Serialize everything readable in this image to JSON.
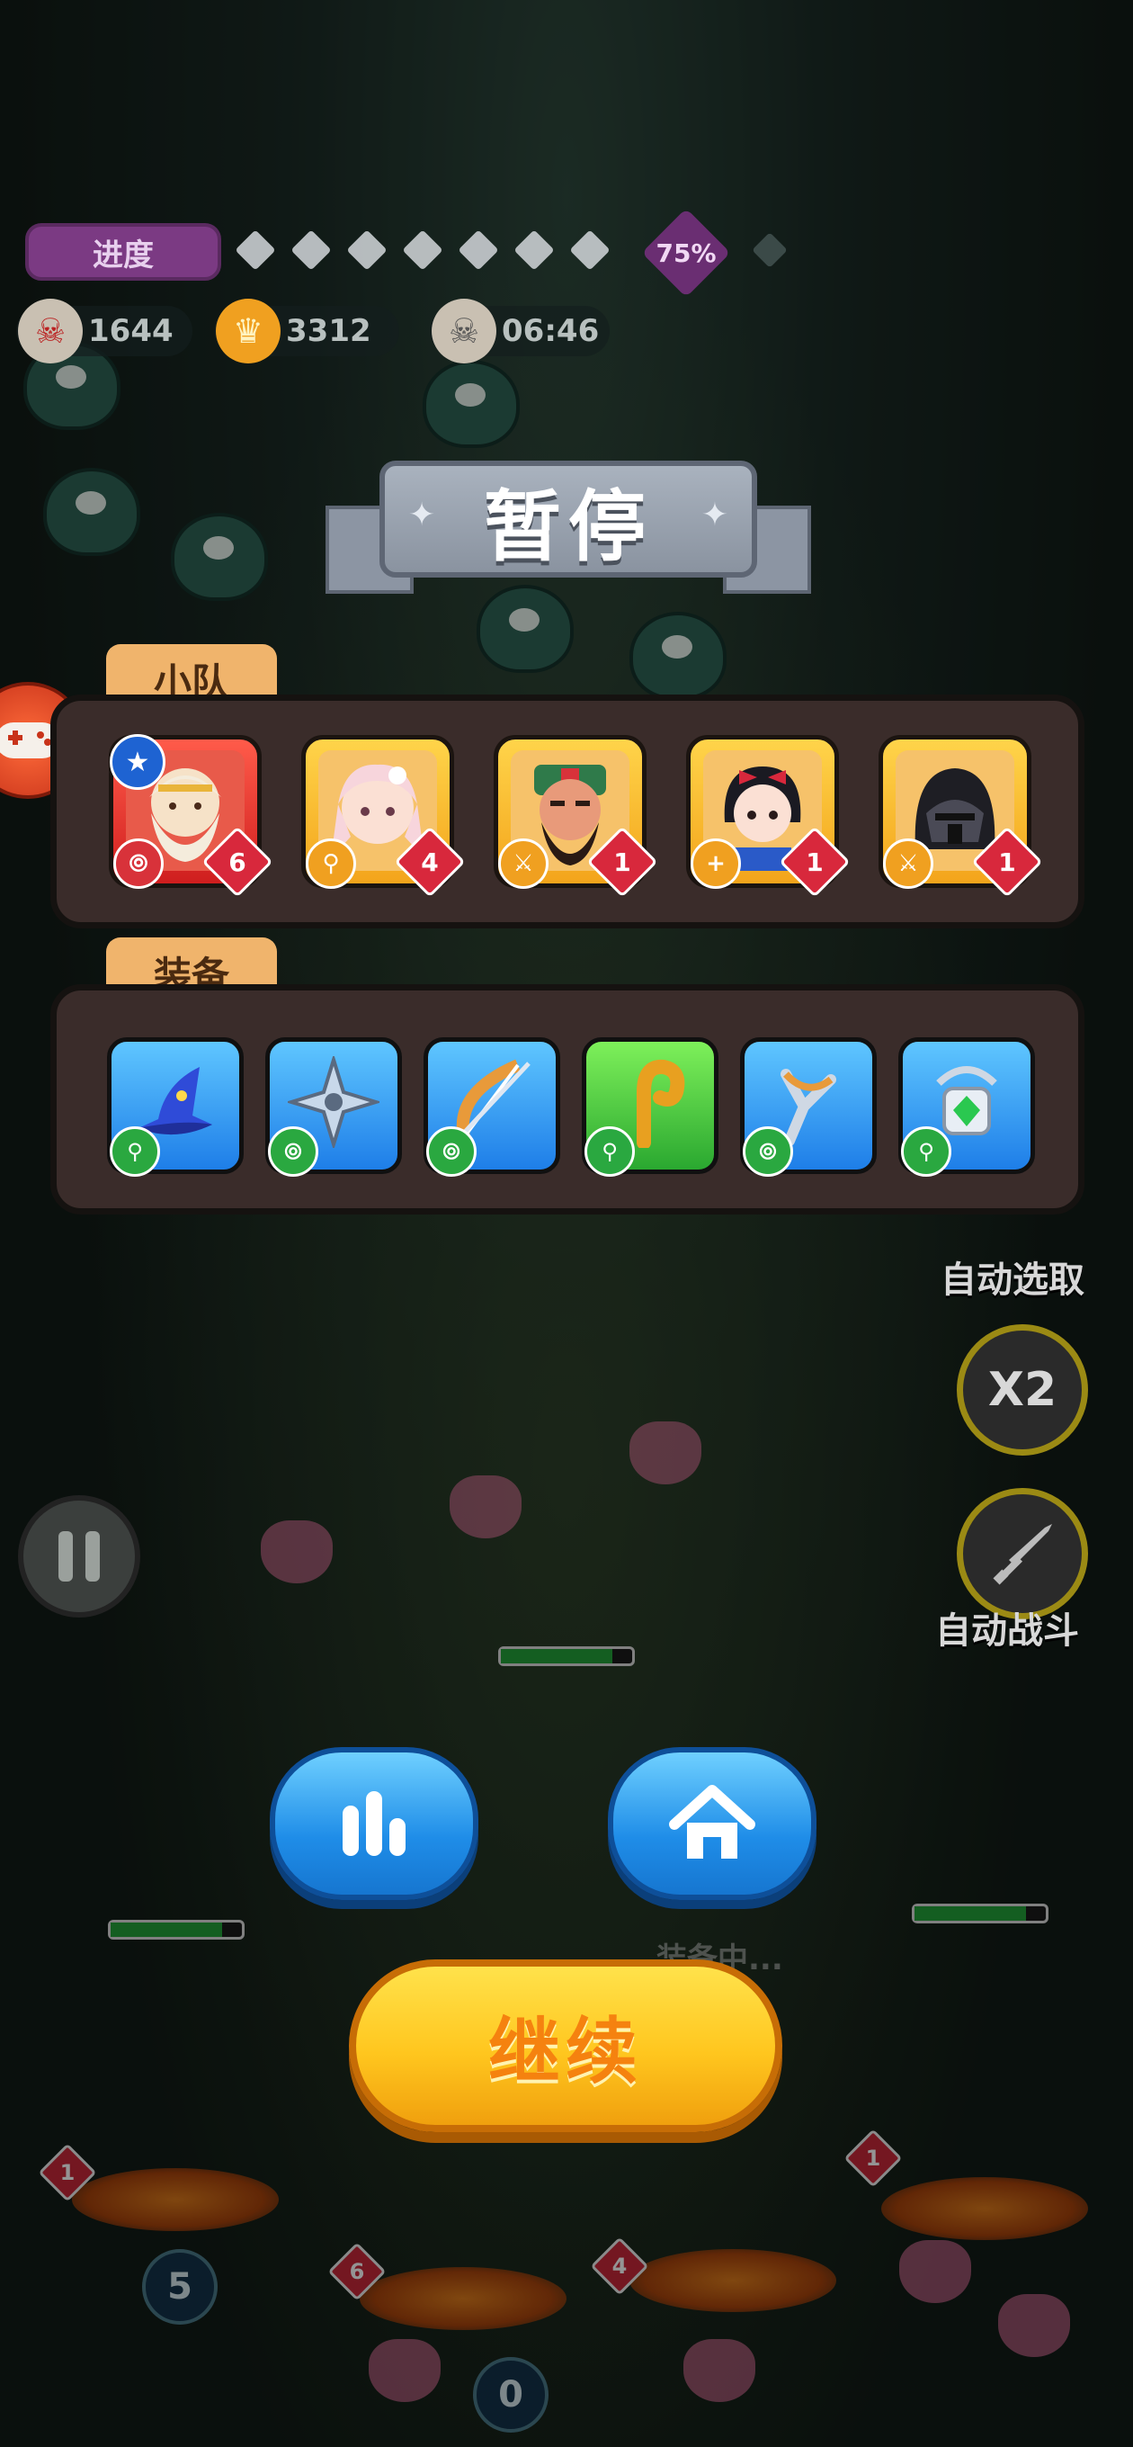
{
  "hud": {
    "progress_label": "进度",
    "progress_percent": "75%",
    "progress_dots": 7,
    "kills": "1644",
    "gold": "3312",
    "timer": "06:46"
  },
  "pause_title": "暂停",
  "team": {
    "label": "小队",
    "heroes": [
      {
        "name": "zeus-hero",
        "level": "6",
        "frame": "red",
        "class_icon": "bow-icon",
        "starred": true
      },
      {
        "name": "fox-girl-hero",
        "level": "4",
        "frame": "gold",
        "class_icon": "staff-icon",
        "starred": false
      },
      {
        "name": "guan-yu-hero",
        "level": "1",
        "frame": "gold",
        "class_icon": "sword-icon",
        "starred": false
      },
      {
        "name": "snow-white-hero",
        "level": "1",
        "frame": "gold",
        "class_icon": "plus-icon",
        "starred": false
      },
      {
        "name": "dark-knight-hero",
        "level": "1",
        "frame": "gold",
        "class_icon": "sword-icon",
        "starred": false
      }
    ]
  },
  "equipment": {
    "label": "装备",
    "items": [
      {
        "name": "wizard-hat-icon",
        "color": "blue",
        "class_icon": "staff-icon"
      },
      {
        "name": "shuriken-icon",
        "color": "blue",
        "class_icon": "bow-icon"
      },
      {
        "name": "bow-weapon-icon",
        "color": "blue",
        "class_icon": "bow-icon"
      },
      {
        "name": "hook-staff-icon",
        "color": "green",
        "class_icon": "staff-icon"
      },
      {
        "name": "slingshot-icon",
        "color": "blue",
        "class_icon": "bow-icon"
      },
      {
        "name": "gem-amulet-icon",
        "color": "blue",
        "class_icon": "staff-icon"
      }
    ]
  },
  "side": {
    "auto_select": "自动选取",
    "speed": "X2",
    "auto_battle": "自动战斗"
  },
  "bottom": {
    "stats_button": "stats-icon",
    "home_button": "home-icon",
    "continue_label": "继续"
  },
  "field": {
    "coin_left": "5",
    "coin_bottom": "0",
    "equipping_text": "装备中..."
  },
  "colors": {
    "gold_frame": "#f3a41b",
    "red_frame": "#cf1e1e",
    "equip_blue": "#1e7ee8",
    "equip_green": "#2aa830",
    "continue_text": "#f5820f"
  }
}
